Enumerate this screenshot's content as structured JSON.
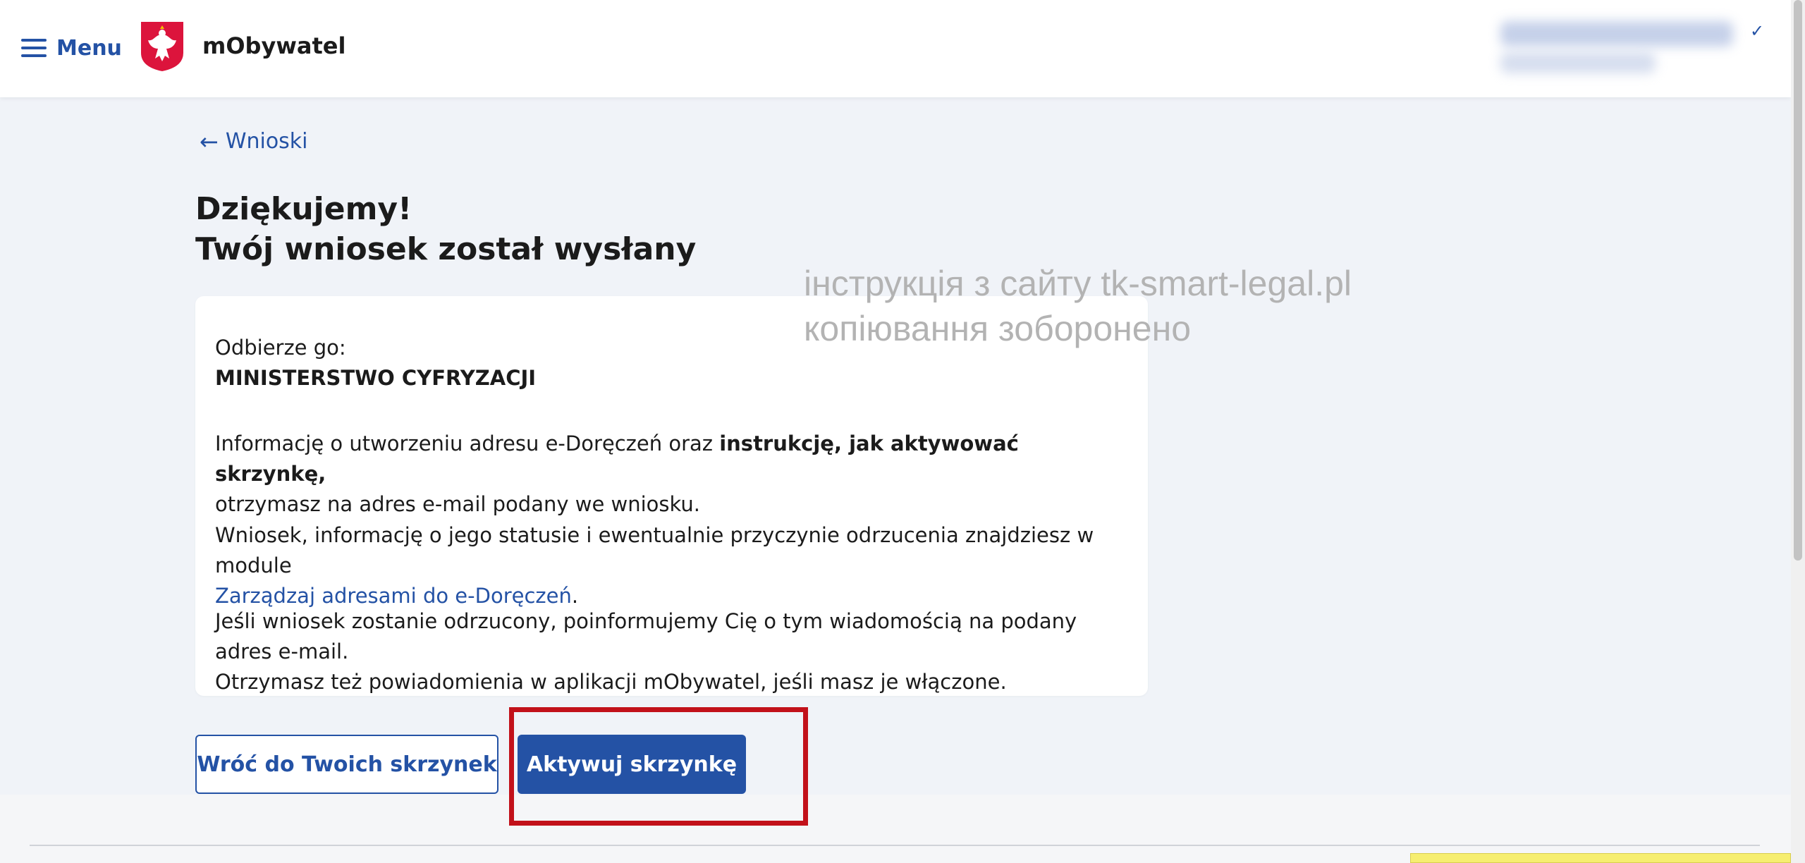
{
  "header": {
    "menu_label": "Menu",
    "app_name": "mObywatel",
    "emblem_icon": "polish-eagle-emblem",
    "check_icon": "✓"
  },
  "back_link": {
    "label": "Wnioski"
  },
  "title": {
    "line1": "Dziękujemy!",
    "line2": "Twój wniosek został wysłany"
  },
  "watermark": {
    "line1": "інструкція з сайту tk-smart-legal.pl",
    "line2": "копіювання зоборонено"
  },
  "card": {
    "recipient_label": "Odbierze go:",
    "recipient_name": "MINISTERSTWO CYFRYZACJI",
    "info_part1": "Informację o utworzeniu adresu e-Doręczeń oraz ",
    "info_bold": "instrukcję, jak aktywować skrzynkę,",
    "info_part2": "otrzymasz na adres e-mail podany we wniosku.",
    "status_text": "Wniosek, informację o jego statusie i ewentualnie przyczynie odrzucenia znajdziesz w module",
    "status_link": "Zarządzaj adresami do e-Doręczeń",
    "status_end": ".",
    "reject_line1": "Jeśli wniosek zostanie odrzucony, poinformujemy Cię o tym wiadomością na podany adres e-mail.",
    "reject_line2": "Otrzymasz też powiadomienia w aplikacji mObywatel, jeśli masz je włączone."
  },
  "buttons": {
    "back_label": "Wróć do Twoich skrzynek",
    "activate_label": "Aktywuj skrzynkę"
  },
  "colors": {
    "accent": "#2452a5",
    "highlight": "#c2111a",
    "background": "#f0f3f8"
  }
}
